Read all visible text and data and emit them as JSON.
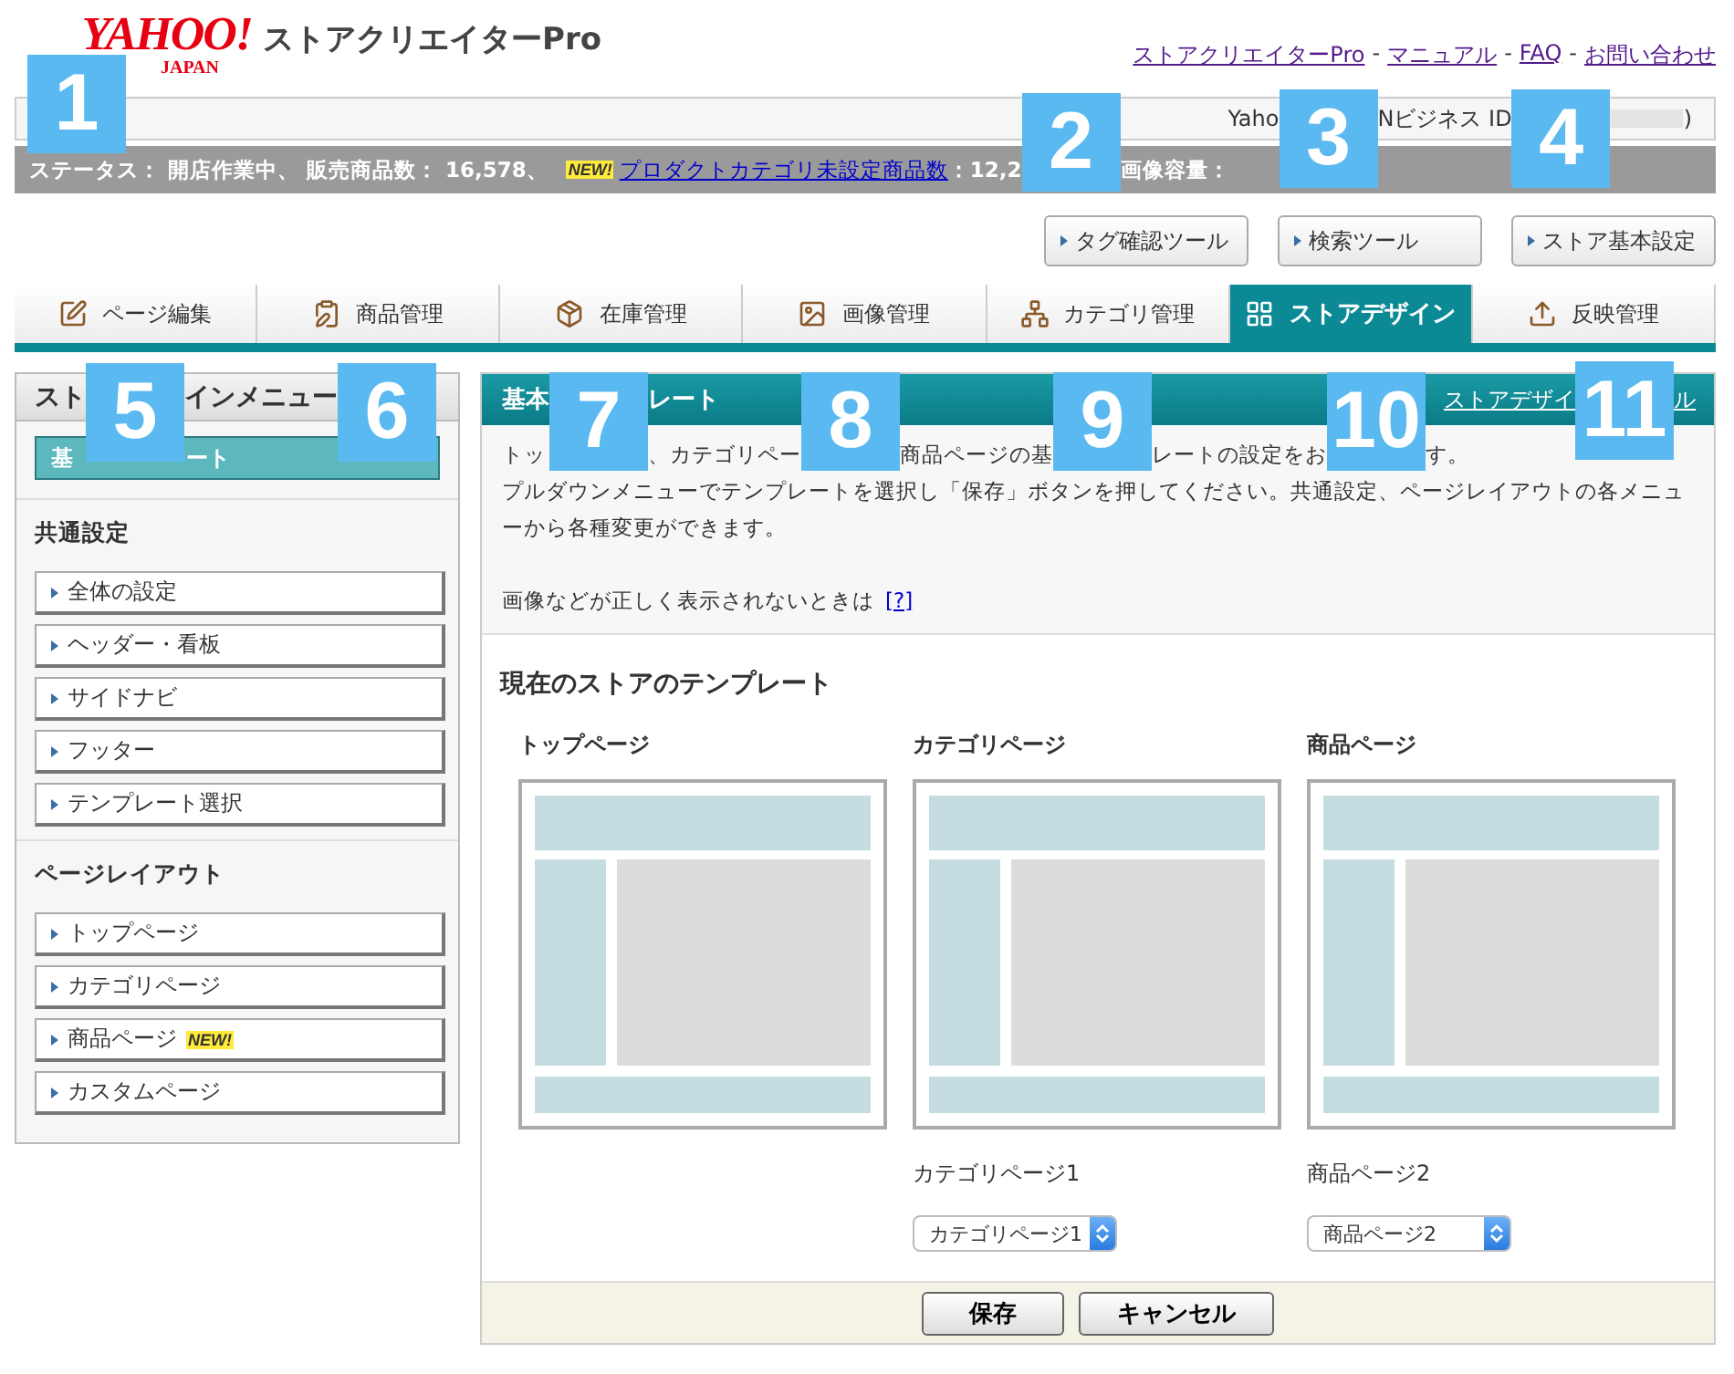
{
  "header": {
    "logo": {
      "main": "YAHOO!",
      "sub": "JAPAN"
    },
    "title": "ストアクリエイターPro",
    "links": [
      "ストアクリエイターPro",
      "マニュアル",
      "FAQ",
      "お問い合わせ"
    ],
    "separator": "-"
  },
  "account_bar": {
    "parts": [
      "Yaho",
      "Nビジネス ID",
      ")"
    ]
  },
  "status_bar": {
    "text": "ステータス： 開店作業中、 販売商品数： 16,578、",
    "badge": "NEW!",
    "link": "プロダクトカテゴリ未設定商品数",
    "count": "：12,2",
    "image_label": "画像容量："
  },
  "tools": [
    "タグ確認ツール",
    "検索ツール",
    "ストア基本設定"
  ],
  "tabs": [
    {
      "label": "ページ編集",
      "selected": false
    },
    {
      "label": "商品管理",
      "selected": false
    },
    {
      "label": "在庫管理",
      "selected": false
    },
    {
      "label": "画像管理",
      "selected": false
    },
    {
      "label": "カテゴリ管理",
      "selected": false
    },
    {
      "label": "ストアデザイン",
      "selected": true
    },
    {
      "label": "反映管理",
      "selected": false
    }
  ],
  "sidebar": {
    "title_parts": [
      "スト",
      "インメニュー"
    ],
    "active_item_parts": [
      "基",
      "ート"
    ],
    "sections": [
      {
        "title": "共通設定",
        "items": [
          {
            "label": "全体の設定"
          },
          {
            "label": "ヘッダー・看板"
          },
          {
            "label": "サイドナビ"
          },
          {
            "label": "フッター"
          },
          {
            "label": "テンプレート選択"
          }
        ]
      },
      {
        "title": "ページレイアウト",
        "items": [
          {
            "label": "トップページ"
          },
          {
            "label": "カテゴリページ"
          },
          {
            "label": "商品ページ",
            "badge": "NEW!"
          },
          {
            "label": "カスタムページ"
          }
        ]
      }
    ]
  },
  "panel": {
    "title_parts": [
      "基本",
      "レート"
    ],
    "link_parts": [
      "ストアデザイ",
      "ル"
    ],
    "intro_parts": [
      "トッ",
      "、カテゴリペー",
      "商品ページの基",
      "レートの設定をお",
      "す。"
    ],
    "instructions": "プルダウンメニューでテンプレートを選択し「保存」ボタンを押してください。共通設定、ページレイアウトの各メニューから各種変更ができます。",
    "help_text": "画像などが正しく表示されないときは",
    "help_link": "[?]",
    "section_title": "現在のストアのテンプレート",
    "templates": [
      {
        "label": "トップページ"
      },
      {
        "label": "カテゴリページ",
        "current": "カテゴリページ1",
        "select": "カテゴリページ1"
      },
      {
        "label": "商品ページ",
        "current": "商品ページ2",
        "select": "商品ページ2"
      }
    ],
    "buttons": [
      "保存",
      "キャンセル"
    ]
  },
  "callouts": [
    "1",
    "2",
    "3",
    "4",
    "5",
    "6",
    "7",
    "8",
    "9",
    "10",
    "11"
  ]
}
